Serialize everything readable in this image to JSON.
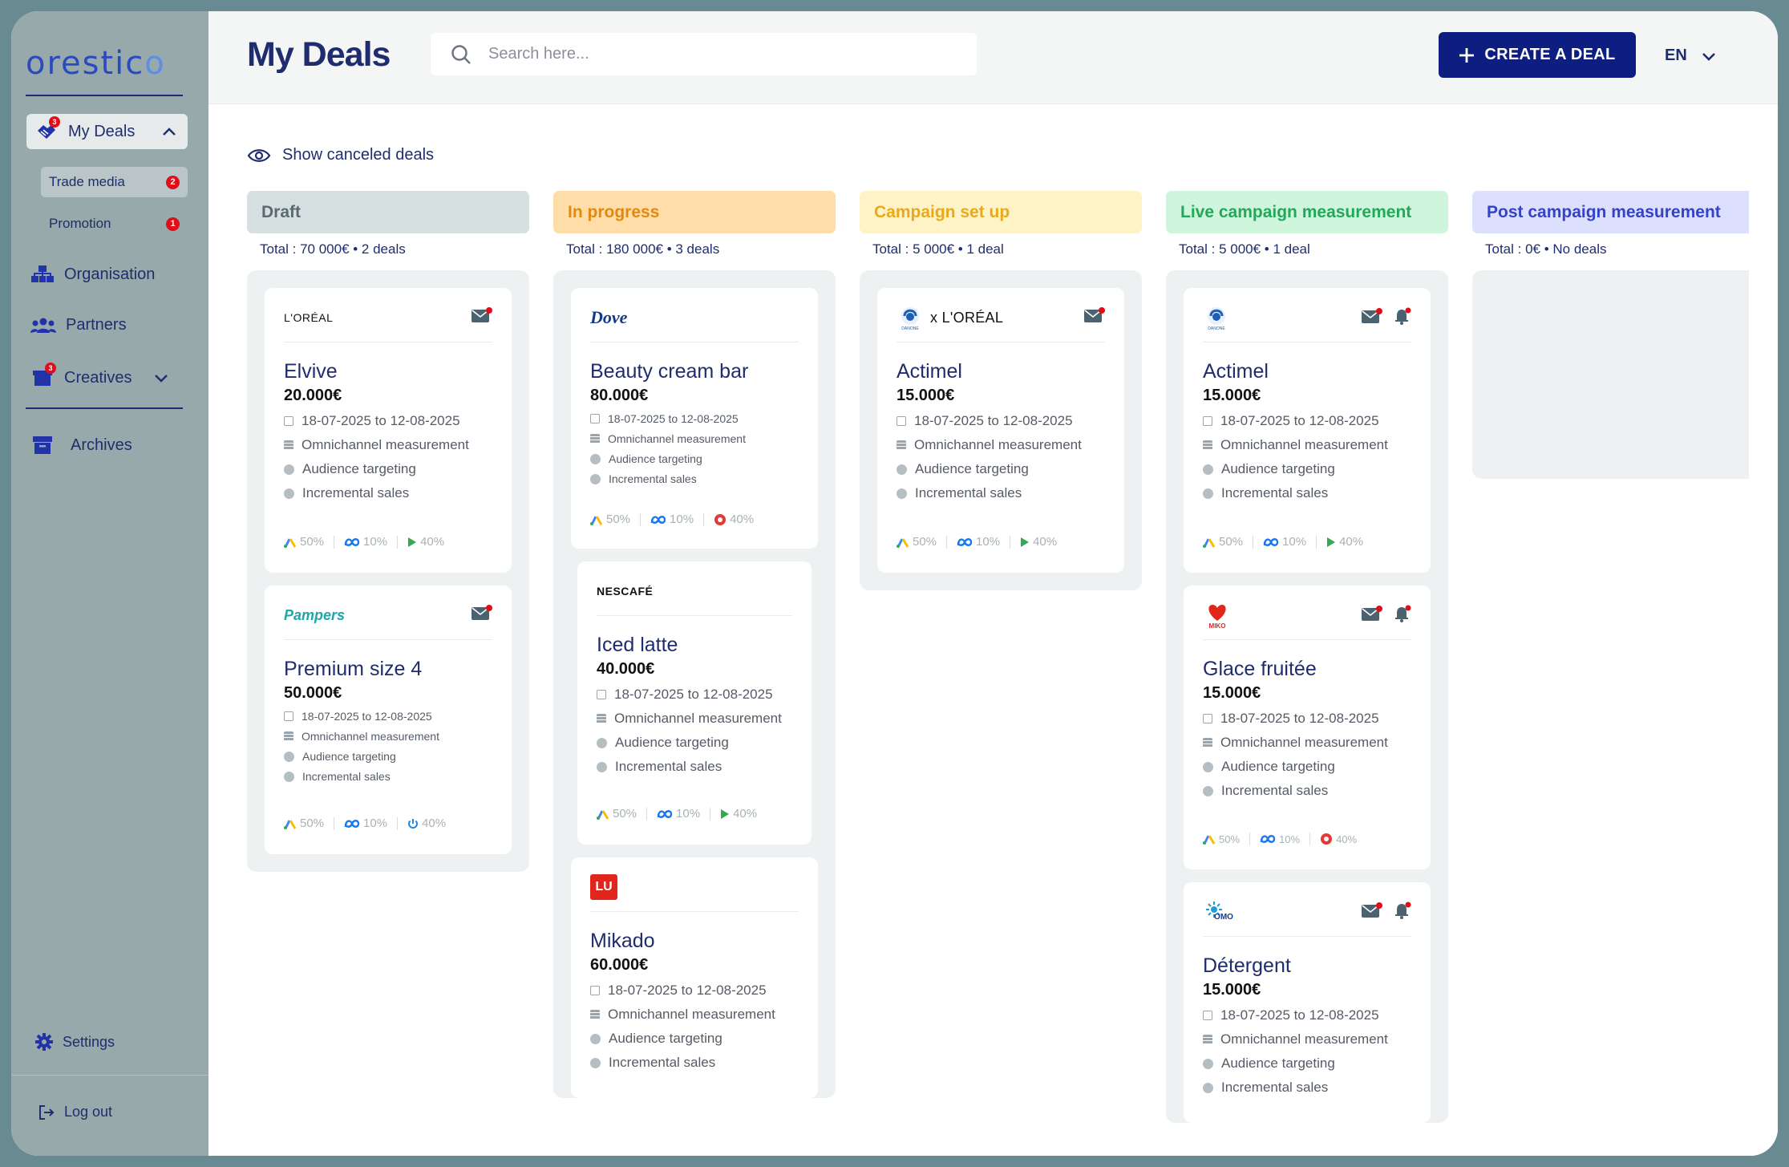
{
  "app": {
    "logo_part1": "orestic",
    "logo_part2": "o"
  },
  "sidebar": {
    "my_deals": {
      "label": "My Deals",
      "badge": "3"
    },
    "sub_items": [
      {
        "label": "Trade media",
        "badge": "2"
      },
      {
        "label": "Promotion",
        "badge": "1"
      }
    ],
    "organisation": "Organisation",
    "partners": "Partners",
    "creatives": {
      "label": "Creatives",
      "badge": "3"
    },
    "archives": "Archives",
    "settings": "Settings",
    "logout": "Log out"
  },
  "header": {
    "title": "My Deals",
    "search_placeholder": "Search here...",
    "create_button": "CREATE A DEAL",
    "language": "EN"
  },
  "show_canceled": "Show canceled deals",
  "columns": [
    {
      "title": "Draft",
      "total": "Total : 70 000€  •  2 deals",
      "header_bg": "#d6e0e1",
      "header_color": "#5b6a70"
    },
    {
      "title": "In progress",
      "total": "Total : 180 000€  •  3 deals",
      "header_bg": "#fedda8",
      "header_color": "#e08a12"
    },
    {
      "title": "Campaign set up",
      "total": "Total : 5 000€  •  1 deal",
      "header_bg": "#fef3c7",
      "header_color": "#eaa91c"
    },
    {
      "title": "Live campaign measurement",
      "total": "Total : 5 000€  •  1 deal",
      "header_bg": "#cff5dc",
      "header_color": "#23a85a"
    },
    {
      "title": "Post campaign measurement",
      "total": "Total : 0€  •  No deals",
      "header_bg": "#dde0fd",
      "header_color": "#3342c9"
    }
  ],
  "cards": {
    "elvive": {
      "brand": "L'ORÉAL",
      "title": "Elvive",
      "amount": "20.000€",
      "dates": "18-07-2025 to 12-08-2025",
      "f1": "Omnichannel measurement",
      "f2": "Audience targeting",
      "f3": "Incremental sales",
      "c1": "50%",
      "c2": "10%",
      "c3": "40%"
    },
    "pampers": {
      "brand": "Pampers",
      "title": "Premium size 4",
      "amount": "50.000€",
      "dates": "18-07-2025 to 12-08-2025",
      "f1": "Omnichannel measurement",
      "f2": "Audience targeting",
      "f3": "Incremental sales",
      "c1": "50%",
      "c2": "10%",
      "c3": "40%"
    },
    "dove": {
      "brand": "Dove",
      "title": "Beauty cream bar",
      "amount": "80.000€",
      "dates": "18-07-2025 to 12-08-2025",
      "f1": "Omnichannel measurement",
      "f2": "Audience targeting",
      "f3": "Incremental sales",
      "c1": "50%",
      "c2": "10%",
      "c3": "40%"
    },
    "nescafe": {
      "brand": "NESCAFÉ",
      "title": "Iced latte",
      "amount": "40.000€",
      "dates": "18-07-2025 to 12-08-2025",
      "f1": "Omnichannel measurement",
      "f2": "Audience targeting",
      "f3": "Incremental sales",
      "c1": "50%",
      "c2": "10%",
      "c3": "40%"
    },
    "mikado": {
      "brand": "LU",
      "title": "Mikado",
      "amount": "60.000€",
      "dates": "18-07-2025 to 12-08-2025",
      "f1": "Omnichannel measurement",
      "f2": "Audience targeting",
      "f3": "Incremental sales"
    },
    "actimel_setup": {
      "brand": "DANONE",
      "partner": "x L'ORÉAL",
      "title": "Actimel",
      "amount": "15.000€",
      "dates": "18-07-2025 to 12-08-2025",
      "f1": "Omnichannel measurement",
      "f2": "Audience targeting",
      "f3": "Incremental sales",
      "c1": "50%",
      "c2": "10%",
      "c3": "40%"
    },
    "actimel_live": {
      "brand": "DANONE",
      "title": "Actimel",
      "amount": "15.000€",
      "dates": "18-07-2025 to 12-08-2025",
      "f1": "Omnichannel measurement",
      "f2": "Audience targeting",
      "f3": "Incremental sales",
      "c1": "50%",
      "c2": "10%",
      "c3": "40%"
    },
    "glace": {
      "brand": "MIKO",
      "title": "Glace fruitée",
      "amount": "15.000€",
      "dates": "18-07-2025 to 12-08-2025",
      "f1": "Omnichannel measurement",
      "f2": "Audience targeting",
      "f3": "Incremental sales",
      "c1": "50%",
      "c2": "10%",
      "c3": "40%"
    },
    "detergent": {
      "brand": "OMO",
      "title": "Détergent",
      "amount": "15.000€",
      "dates": "18-07-2025 to 12-08-2025",
      "f1": "Omnichannel measurement",
      "f2": "Audience targeting",
      "f3": "Incremental sales"
    }
  }
}
